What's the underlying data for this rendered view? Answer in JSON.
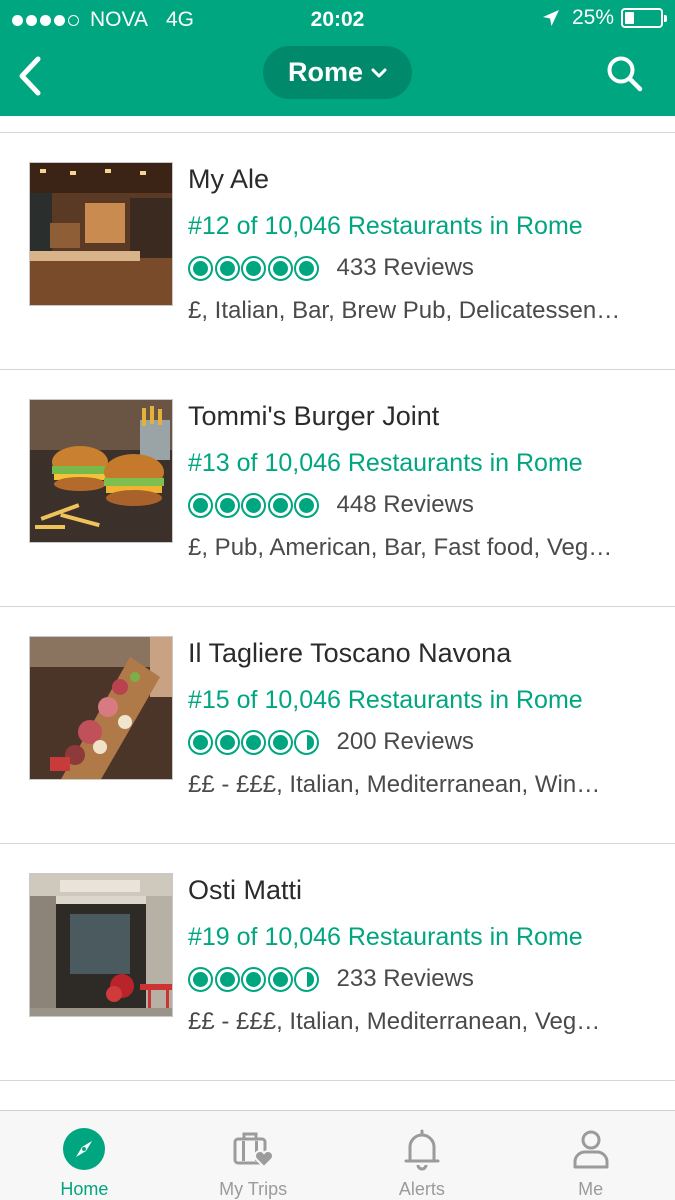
{
  "status_bar": {
    "carrier": "NOVA",
    "network": "4G",
    "time": "20:02",
    "battery_percent_label": "25%",
    "battery_level": 0.25,
    "signal_bars_filled": 4,
    "signal_bars_total": 5
  },
  "header": {
    "city": "Rome",
    "icons": {
      "back": "back-chevron-icon",
      "city_dropdown": "chevron-down-icon",
      "search": "search-icon"
    }
  },
  "restaurants": [
    {
      "name": "My Ale",
      "rank": "#12 of 10,046 Restaurants in Rome",
      "rating": 5,
      "reviews": "433 Reviews",
      "categories": "£, Italian, Bar, Brew Pub, Delicatessen…"
    },
    {
      "name": "Tommi's Burger Joint",
      "rank": "#13 of 10,046 Restaurants in Rome",
      "rating": 5,
      "reviews": "448 Reviews",
      "categories": "£, Pub, American, Bar, Fast food, Veg…"
    },
    {
      "name": "Il Tagliere Toscano Navona",
      "rank": "#15 of 10,046 Restaurants in Rome",
      "rating": 4.5,
      "reviews": "200 Reviews",
      "categories": "££ - £££, Italian, Mediterranean, Win…"
    },
    {
      "name": "Osti Matti",
      "rank": "#19 of 10,046 Restaurants in Rome",
      "rating": 4.5,
      "reviews": "233 Reviews",
      "categories": "££ - £££, Italian, Mediterranean, Veg…"
    }
  ],
  "bottom_nav": [
    {
      "label": "Home",
      "icon": "compass-icon",
      "active": true
    },
    {
      "label": "My Trips",
      "icon": "suitcase-heart-icon",
      "active": false
    },
    {
      "label": "Alerts",
      "icon": "bell-icon",
      "active": false
    },
    {
      "label": "Me",
      "icon": "person-icon",
      "active": false
    }
  ],
  "colors": {
    "brand_green": "#00a680",
    "brand_green_dark": "#008a6b",
    "divider": "#d6d6d6",
    "inactive_nav": "#9b9b9b"
  }
}
